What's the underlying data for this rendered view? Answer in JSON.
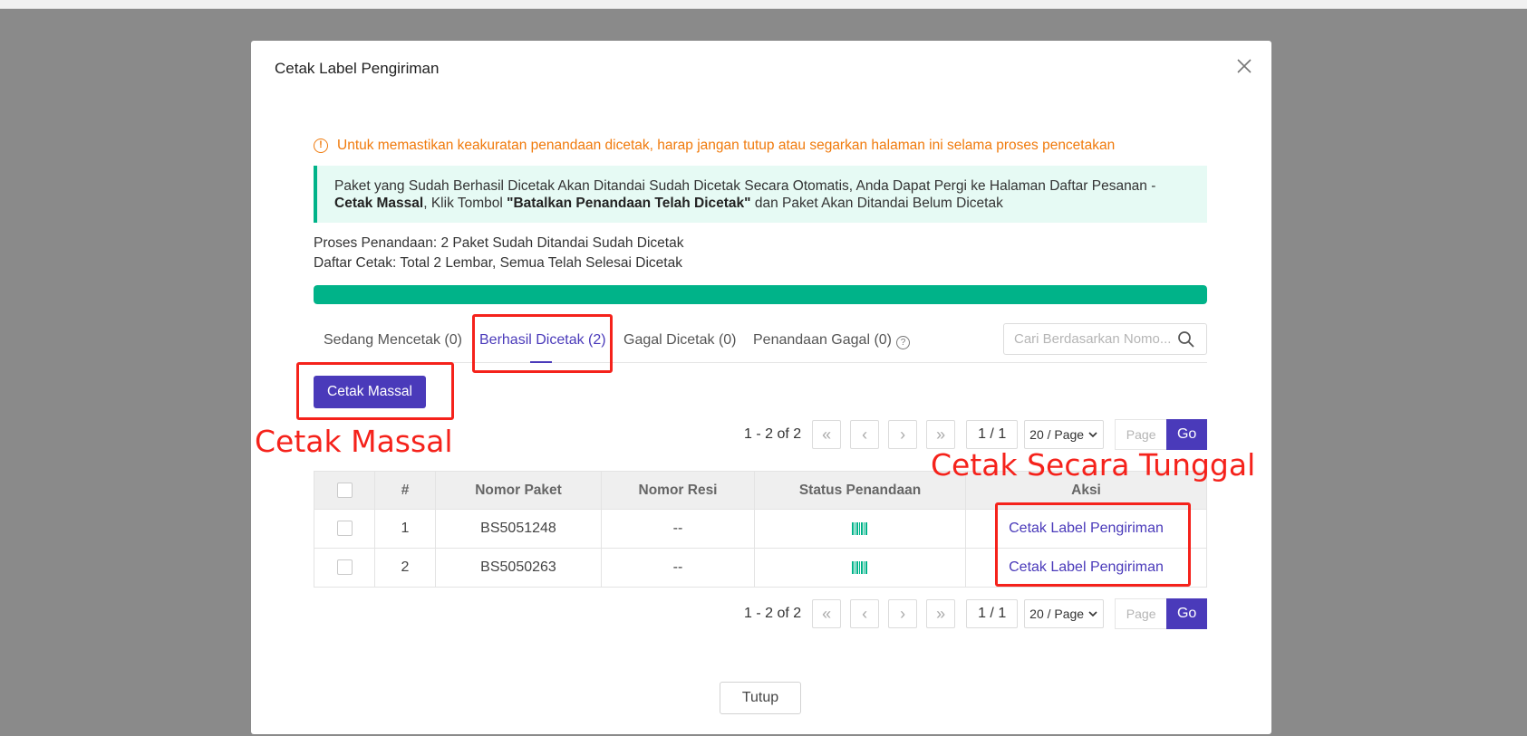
{
  "modal": {
    "title": "Cetak Label Pengiriman",
    "warning": "Untuk memastikan keakuratan penandaan dicetak, harap jangan tutup atau segarkan halaman ini selama proses pencetakan",
    "info": {
      "line1": "Paket yang Sudah Berhasil Dicetak Akan Ditandai Sudah Dicetak Secara Otomatis, Anda Dapat Pergi ke Halaman Daftar Pesanan -",
      "bold1": "Cetak Massal",
      "mid": ", Klik Tombol ",
      "bold2": "\"Batalkan Penandaan Telah Dicetak\"",
      "end": " dan Paket Akan Ditandai Belum Dicetak"
    },
    "progress_line1": "Proses Penandaan: 2 Paket Sudah Ditandai Sudah Dicetak",
    "progress_line2": "Daftar Cetak: Total 2 Lembar, Semua Telah Selesai Dicetak",
    "progress_percent": 100,
    "close_button": "Tutup"
  },
  "tabs": [
    {
      "label": "Sedang Mencetak (0)",
      "active": false
    },
    {
      "label": "Berhasil Dicetak (2)",
      "active": true
    },
    {
      "label": "Gagal Dicetak (0)",
      "active": false
    },
    {
      "label": "Penandaan Gagal (0)",
      "active": false
    }
  ],
  "search": {
    "placeholder": "Cari Berdasarkan Nomo..."
  },
  "bulk_button": "Cetak Massal",
  "pagination": {
    "range": "1 - 2 of 2",
    "page": "1 / 1",
    "page_size": "20 / Page",
    "page_placeholder": "Page",
    "go": "Go"
  },
  "annotations": {
    "bulk": "Cetak Massal",
    "single": "Cetak Secara Tunggal"
  },
  "table": {
    "headers": [
      "#",
      "Nomor Paket",
      "Nomor Resi",
      "Status Penandaan",
      "Aksi"
    ],
    "rows": [
      {
        "no": "1",
        "package": "BS5051248",
        "resi": "--",
        "action": "Cetak Label Pengiriman"
      },
      {
        "no": "2",
        "package": "BS5050263",
        "resi": "--",
        "action": "Cetak Label Pengiriman"
      }
    ]
  },
  "colors": {
    "accent": "#4a3aba",
    "success": "#00b389",
    "warning": "#f07a0c",
    "annotation": "#f5221b"
  }
}
